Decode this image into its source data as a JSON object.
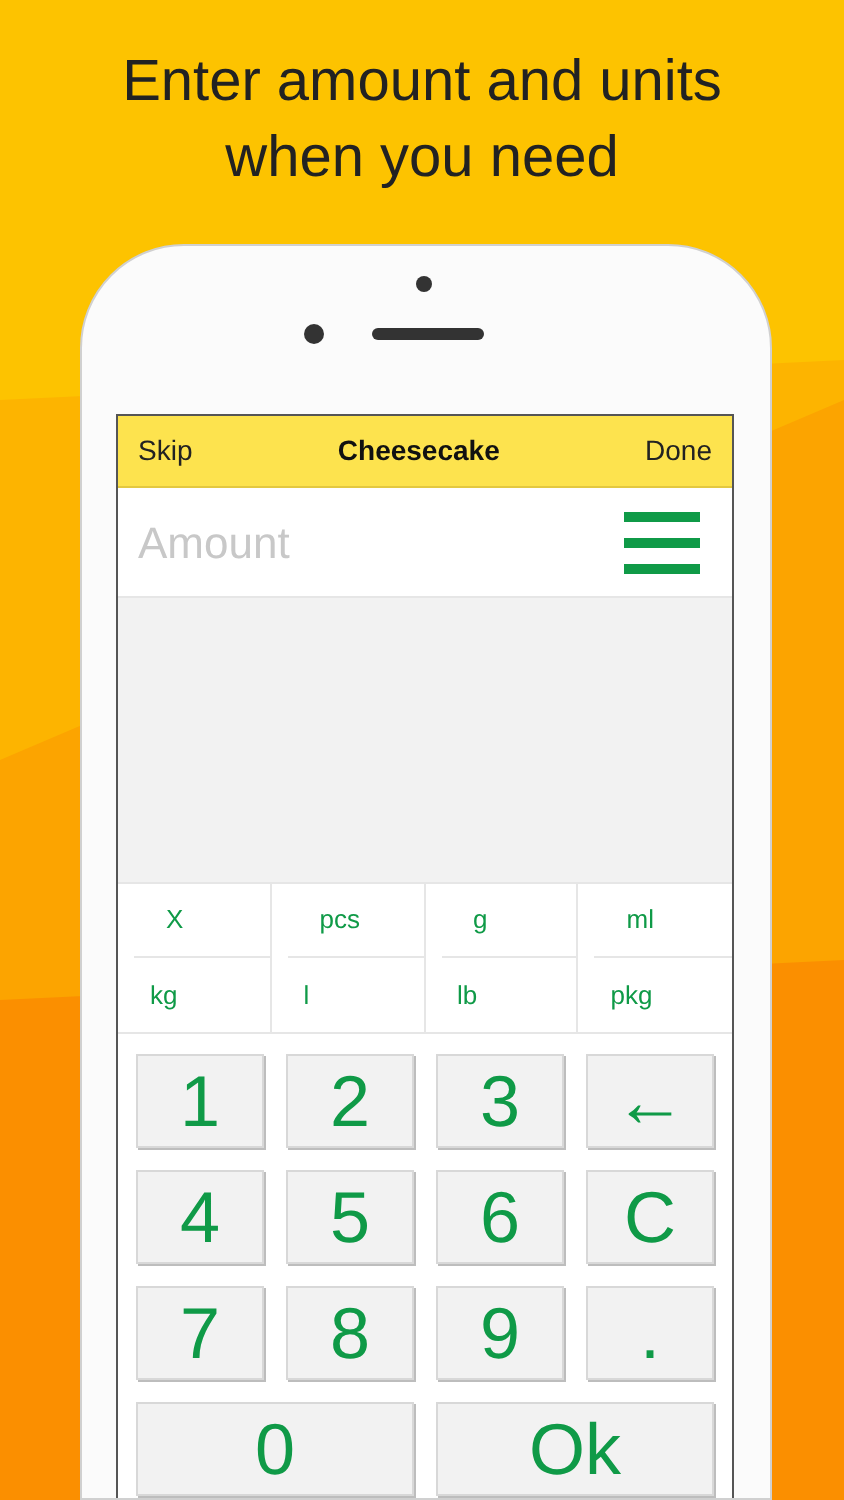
{
  "headline": "Enter amount and units\nwhen you need",
  "nav": {
    "left": "Skip",
    "title": "Cheesecake",
    "right": "Done"
  },
  "amount": {
    "placeholder": "Amount"
  },
  "units": [
    [
      "X",
      "pcs",
      "g",
      "ml"
    ],
    [
      "kg",
      "l",
      "lb",
      "pkg"
    ]
  ],
  "keys": [
    {
      "label": "1",
      "wide": false
    },
    {
      "label": "2",
      "wide": false
    },
    {
      "label": "3",
      "wide": false
    },
    {
      "label": "←",
      "wide": false
    },
    {
      "label": "4",
      "wide": false
    },
    {
      "label": "5",
      "wide": false
    },
    {
      "label": "6",
      "wide": false
    },
    {
      "label": "C",
      "wide": false
    },
    {
      "label": "7",
      "wide": false
    },
    {
      "label": "8",
      "wide": false
    },
    {
      "label": "9",
      "wide": false
    },
    {
      "label": ".",
      "wide": false
    },
    {
      "label": "0",
      "wide": true
    },
    {
      "label": "Ok",
      "wide": true
    }
  ]
}
